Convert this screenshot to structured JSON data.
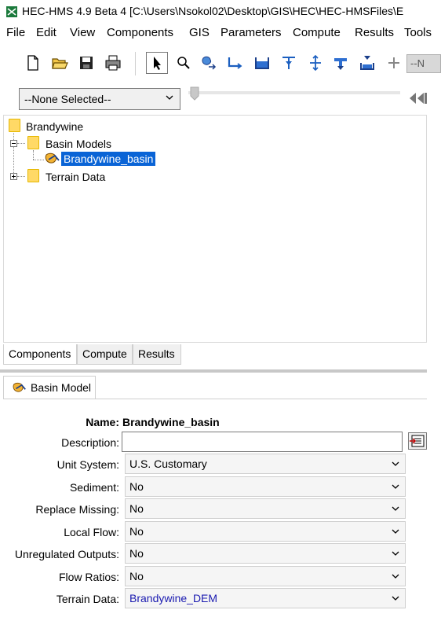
{
  "window": {
    "title": "HEC-HMS 4.9 Beta 4 [C:\\Users\\Nsokol02\\Desktop\\GIS\\HEC\\HEC-HMSFiles\\E"
  },
  "menu": [
    "File",
    "Edit",
    "View",
    "Components",
    "GIS",
    "Parameters",
    "Compute",
    "Results",
    "Tools"
  ],
  "toolbar": {
    "icons": [
      "new-file-icon",
      "open-folder-icon",
      "save-icon",
      "print-icon",
      "arrow-pointer-icon",
      "zoom-icon",
      "subbasin-icon",
      "reach-icon",
      "reservoir-icon",
      "junction-icon",
      "diversion-icon",
      "source-icon",
      "sink-icon",
      "add-icon"
    ],
    "overflow_text": "--N"
  },
  "selector": {
    "value": "--None Selected--"
  },
  "tree": {
    "root": "Brandywine",
    "basin_models": "Basin Models",
    "basin_item": "Brandywine_basin",
    "terrain": "Terrain Data"
  },
  "tabs": [
    "Components",
    "Compute",
    "Results"
  ],
  "basin_tab": "Basin Model",
  "form": {
    "name_label": "Name:",
    "name_value": "Brandywine_basin",
    "description_label": "Description:",
    "description_value": "",
    "fields": [
      {
        "label": "Unit System:",
        "value": "U.S. Customary"
      },
      {
        "label": "Sediment:",
        "value": "No"
      },
      {
        "label": "Replace Missing:",
        "value": "No"
      },
      {
        "label": "Local Flow:",
        "value": "No"
      },
      {
        "label": "Unregulated Outputs:",
        "value": "No"
      },
      {
        "label": "Flow Ratios:",
        "value": "No"
      },
      {
        "label": "Terrain Data:",
        "value": "Brandywine_DEM"
      }
    ]
  },
  "colors": {
    "selection": "#0a64d6",
    "folder": "#ffd966",
    "link_value": "#1a1ab0"
  }
}
